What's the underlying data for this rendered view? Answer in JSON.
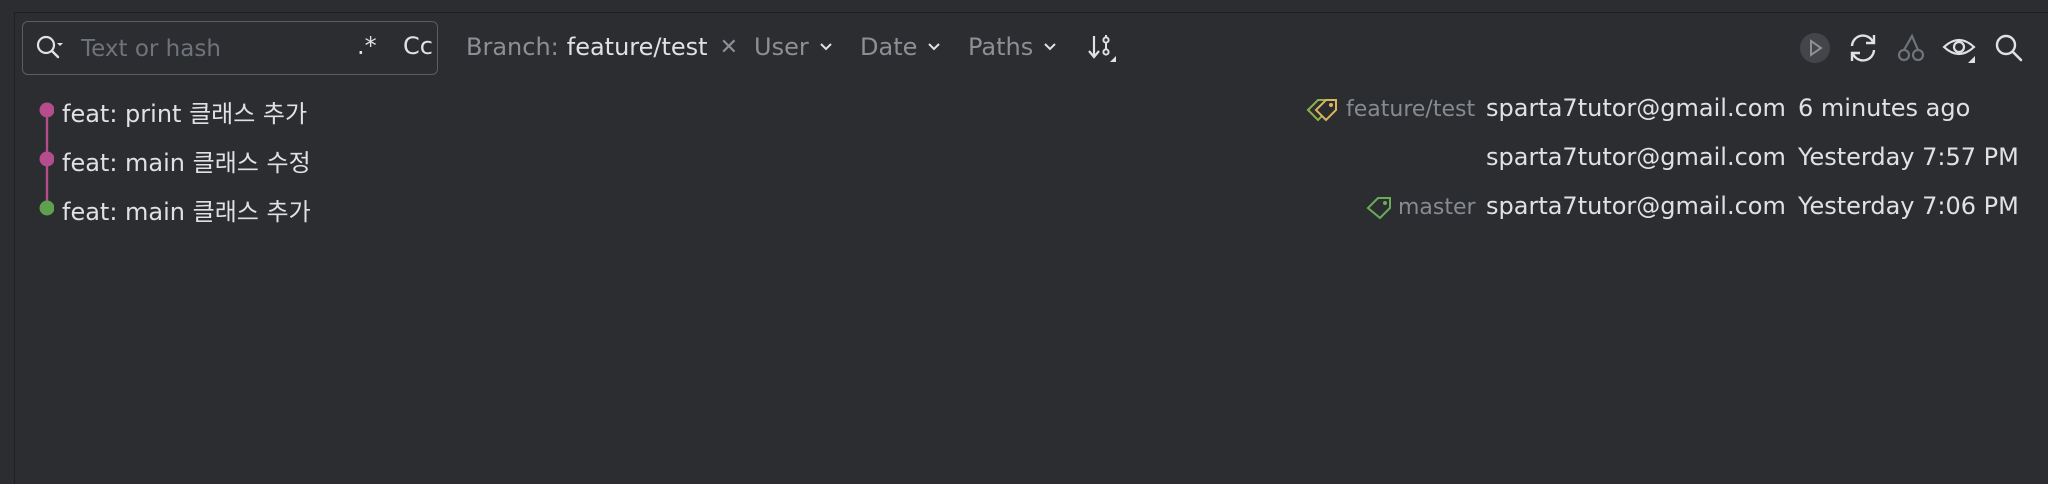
{
  "search": {
    "placeholder": "Text or hash",
    "regex_label": ".*",
    "case_label": "Cc"
  },
  "filters": {
    "branch_label": "Branch:",
    "branch_value": "feature/test",
    "user_label": "User",
    "date_label": "Date",
    "paths_label": "Paths"
  },
  "toolbar_icons": [
    "sort-icon",
    "run-icon",
    "refresh-icon",
    "cherry-pick-icon",
    "eye-icon",
    "search-icon"
  ],
  "commits": [
    {
      "subject": "feat: print 클래스 추가",
      "ref": "feature/test",
      "author": "sparta7tutor@gmail.com",
      "date": "6 minutes ago",
      "node_color": "#b54d8c"
    },
    {
      "subject": "feat: main 클래스 수정",
      "ref": "",
      "author": "sparta7tutor@gmail.com",
      "date": "Yesterday 7:57 PM",
      "node_color": "#b54d8c"
    },
    {
      "subject": "feat: main 클래스 추가",
      "ref": "master",
      "author": "sparta7tutor@gmail.com",
      "date": "Yesterday 7:06 PM",
      "node_color": "#5fa04e"
    }
  ],
  "colors": {
    "background": "#2b2d30",
    "text": "#dfe1e5",
    "muted": "#868a91",
    "branch_line": "#b54d8c",
    "master_node": "#5fa04e",
    "tag_green": "#6aab5a"
  }
}
